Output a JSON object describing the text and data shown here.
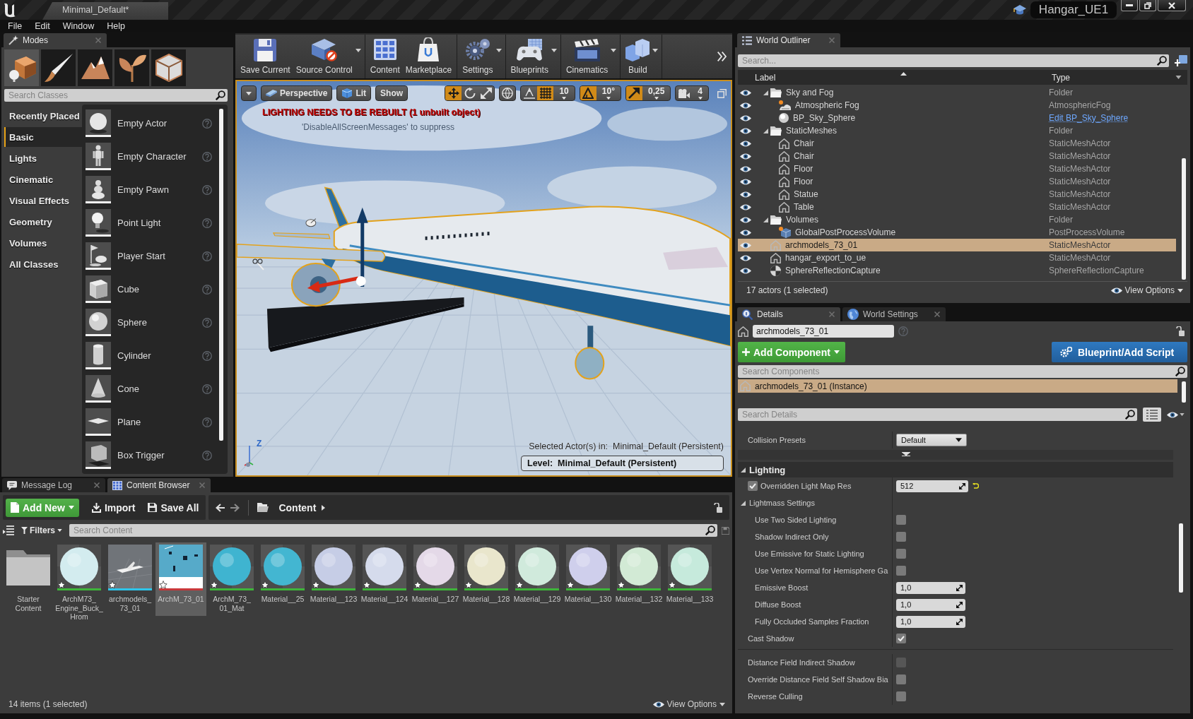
{
  "title_bar": {
    "document": "Minimal_Default*",
    "project": "Hangar_UE1"
  },
  "menu": [
    "File",
    "Edit",
    "Window",
    "Help"
  ],
  "modes": {
    "tab": "Modes",
    "mode_buttons": [
      {
        "kind": "place",
        "selected": true
      },
      {
        "kind": "paint",
        "selected": false
      },
      {
        "kind": "landscape",
        "selected": false
      },
      {
        "kind": "foliage",
        "selected": false
      },
      {
        "kind": "geometry",
        "selected": false
      }
    ],
    "search": {
      "placeholder": "Search Classes"
    },
    "categories": [
      {
        "label": "Recently Placed",
        "selected": false
      },
      {
        "label": "Basic",
        "selected": true
      },
      {
        "label": "Lights",
        "selected": false
      },
      {
        "label": "Cinematic",
        "selected": false
      },
      {
        "label": "Visual Effects",
        "selected": false
      },
      {
        "label": "Geometry",
        "selected": false
      },
      {
        "label": "Volumes",
        "selected": false
      },
      {
        "label": "All Classes",
        "selected": false
      }
    ],
    "items": [
      {
        "label": "Empty Actor",
        "kind": "ball"
      },
      {
        "label": "Empty Character",
        "kind": "figure"
      },
      {
        "label": "Empty Pawn",
        "kind": "pawn"
      },
      {
        "label": "Point Light",
        "kind": "bulb"
      },
      {
        "label": "Player Start",
        "kind": "flag"
      },
      {
        "label": "Cube",
        "kind": "cube"
      },
      {
        "label": "Sphere",
        "kind": "sphere"
      },
      {
        "label": "Cylinder",
        "kind": "cylinder"
      },
      {
        "label": "Cone",
        "kind": "cone"
      },
      {
        "label": "Plane",
        "kind": "plane"
      },
      {
        "label": "Box Trigger",
        "kind": "trigger"
      }
    ]
  },
  "toolbar": {
    "groups": [
      [
        {
          "label": "Save Current",
          "kind": "save",
          "dropdown": false
        },
        {
          "label": "Source Control",
          "kind": "source",
          "dropdown": true
        }
      ],
      [
        {
          "label": "Content",
          "kind": "content",
          "dropdown": false
        },
        {
          "label": "Marketplace",
          "kind": "market",
          "dropdown": false
        }
      ],
      [
        {
          "label": "Settings",
          "kind": "settings",
          "dropdown": true
        }
      ],
      [
        {
          "label": "Blueprints",
          "kind": "blueprints",
          "dropdown": true
        }
      ],
      [
        {
          "label": "Cinematics",
          "kind": "cinematics",
          "dropdown": true
        }
      ],
      [
        {
          "label": "Build",
          "kind": "build",
          "dropdown": true
        }
      ]
    ]
  },
  "viewport": {
    "buttons": [
      {
        "label": "Perspective",
        "kind": "perspective"
      },
      {
        "label": "Lit",
        "kind": "lit"
      },
      {
        "label": "Show",
        "kind": "plain"
      }
    ],
    "tool_groups": [
      [
        {
          "kind": "translate",
          "on": true
        },
        {
          "kind": "rotate",
          "on": false
        },
        {
          "kind": "scale",
          "on": false
        }
      ],
      [
        {
          "kind": "world",
          "on": false
        }
      ],
      [
        {
          "kind": "surface",
          "on": false
        },
        {
          "kind": "grid",
          "on": true,
          "value": "10"
        }
      ],
      [
        {
          "kind": "angle",
          "on": true,
          "value": "10°"
        }
      ],
      [
        {
          "kind": "scalesnap",
          "on": true,
          "value": "0,25"
        }
      ],
      [
        {
          "kind": "camera",
          "on": false,
          "value": "4"
        }
      ]
    ],
    "warning": "LIGHTING NEEDS TO BE REBUILT (1 unbuilt object)",
    "hint": "'DisableAllScreenMessages' to suppress",
    "axis": "Z",
    "selection": "Selected Actor(s) in:  Minimal_Default (Persistent)",
    "level": "Level:  Minimal_Default (Persistent)"
  },
  "content_browser": {
    "tabs": [
      {
        "label": "Message Log",
        "kind": "log",
        "selected": false
      },
      {
        "label": "Content Browser",
        "kind": "browser",
        "selected": true
      }
    ],
    "add_new": "Add New",
    "import": "Import",
    "save_all": "Save All",
    "path": "Content",
    "filters": "Filters",
    "search": {
      "placeholder": "Search Content"
    },
    "assets": [
      {
        "label": "Starter Content",
        "kind": "folder",
        "selected": false
      },
      {
        "label": "ArchM73_Engine_Buck_Hrom",
        "kind": "material",
        "color": "#d3ecef",
        "selected": false
      },
      {
        "label": "archmodels_73_01",
        "kind": "mesh",
        "selected": false
      },
      {
        "label": "ArchM_73_01",
        "kind": "texture",
        "selected": true
      },
      {
        "label": "ArchM_73_01_Mat",
        "kind": "material",
        "color": "#3fb4d0",
        "selected": false
      },
      {
        "label": "Material__25",
        "kind": "material",
        "color": "#43b6d1",
        "selected": false
      },
      {
        "label": "Material__123",
        "kind": "material",
        "color": "#c6cde6",
        "selected": false
      },
      {
        "label": "Material__124",
        "kind": "material",
        "color": "#d5dbec",
        "selected": false
      },
      {
        "label": "Material__127",
        "kind": "material",
        "color": "#e4d9e8",
        "selected": false
      },
      {
        "label": "Material__128",
        "kind": "material",
        "color": "#e9e6cc",
        "selected": false
      },
      {
        "label": "Material__129",
        "kind": "material",
        "color": "#d0eadc",
        "selected": false
      },
      {
        "label": "Material__130",
        "kind": "material",
        "color": "#cfcfec",
        "selected": false
      },
      {
        "label": "Material__132",
        "kind": "material",
        "color": "#d2ead5",
        "selected": false
      },
      {
        "label": "Material__133",
        "kind": "material",
        "color": "#c6eadc",
        "selected": false
      }
    ],
    "status": "14 items (1 selected)",
    "view_options": "View Options"
  },
  "outliner": {
    "tab": "World Outliner",
    "search": {
      "placeholder": "Search..."
    },
    "columns": [
      "Label",
      "Type"
    ],
    "rows": [
      {
        "label": "Sky and Fog",
        "kind": "folder",
        "type": "Folder",
        "link": false,
        "selected": false,
        "expanded": true,
        "children": [
          {
            "label": "Atmospheric Fog",
            "kind": "fog",
            "type": "AtmosphericFog",
            "link": false,
            "selected": false
          },
          {
            "label": "BP_Sky_Sphere",
            "kind": "sphere",
            "type": "Edit BP_Sky_Sphere",
            "link": true,
            "selected": false
          }
        ]
      },
      {
        "label": "StaticMeshes",
        "kind": "folder",
        "type": "Folder",
        "link": false,
        "selected": false,
        "expanded": true,
        "children": [
          {
            "label": "Chair",
            "kind": "mesh",
            "type": "StaticMeshActor",
            "link": false,
            "selected": false
          },
          {
            "label": "Chair",
            "kind": "mesh",
            "type": "StaticMeshActor",
            "link": false,
            "selected": false
          },
          {
            "label": "Floor",
            "kind": "mesh",
            "type": "StaticMeshActor",
            "link": false,
            "selected": false
          },
          {
            "label": "Floor",
            "kind": "mesh",
            "type": "StaticMeshActor",
            "link": false,
            "selected": false
          },
          {
            "label": "Statue",
            "kind": "mesh",
            "type": "StaticMeshActor",
            "link": false,
            "selected": false
          },
          {
            "label": "Table",
            "kind": "mesh",
            "type": "StaticMeshActor",
            "link": false,
            "selected": false
          }
        ]
      },
      {
        "label": "Volumes",
        "kind": "folder",
        "type": "Folder",
        "link": false,
        "selected": false,
        "expanded": true,
        "children": [
          {
            "label": "GlobalPostProcessVolume",
            "kind": "volume",
            "type": "PostProcessVolume",
            "link": false,
            "selected": false
          }
        ]
      },
      {
        "label": "archmodels_73_01",
        "kind": "mesh",
        "type": "StaticMeshActor",
        "link": false,
        "selected": true
      },
      {
        "label": "hangar_export_to_ue",
        "kind": "mesh",
        "type": "StaticMeshActor",
        "link": false,
        "selected": false
      },
      {
        "label": "SphereReflectionCapture",
        "kind": "capture",
        "type": "SphereReflectionCapture",
        "link": false,
        "selected": false
      }
    ],
    "status": "17 actors (1 selected)",
    "view_options": "View Options"
  },
  "details": {
    "tabs": [
      {
        "label": "Details",
        "kind": "details",
        "selected": true
      },
      {
        "label": "World Settings",
        "kind": "world",
        "selected": false
      }
    ],
    "actor": {
      "value": "archmodels_73_01"
    },
    "add_component": "Add Component",
    "blueprint": "Blueprint/Add Script",
    "component_search": {
      "placeholder": "Search Components"
    },
    "components": [
      {
        "label": "archmodels_73_01 (Instance)",
        "selected": true
      }
    ],
    "search": {
      "placeholder": "Search Details"
    },
    "properties": [
      {
        "kind": "dropdown",
        "label": "Collision Presets",
        "value": "Default"
      },
      {
        "kind": "advanced"
      },
      {
        "kind": "section",
        "label": "Lighting",
        "expanded": true
      },
      {
        "kind": "number",
        "label": "Overridden Light Map Res",
        "value": "512",
        "checked": true,
        "reset": true
      },
      {
        "kind": "group",
        "label": "Lightmass Settings",
        "expanded": true,
        "children": [
          {
            "kind": "checkbox",
            "label": "Use Two Sided Lighting",
            "checked": false,
            "disabled": false
          },
          {
            "kind": "checkbox",
            "label": "Shadow Indirect Only",
            "checked": false,
            "disabled": false
          },
          {
            "kind": "checkbox",
            "label": "Use Emissive for Static Lighting",
            "checked": false,
            "disabled": false
          },
          {
            "kind": "checkbox",
            "label": "Use Vertex Normal for Hemisphere Ga",
            "checked": false,
            "disabled": false
          },
          {
            "kind": "number",
            "label": "Emissive Boost",
            "value": "1,0",
            "reset": false
          },
          {
            "kind": "number",
            "label": "Diffuse Boost",
            "value": "1,0",
            "reset": false
          },
          {
            "kind": "number",
            "label": "Fully Occluded Samples Fraction",
            "value": "1,0",
            "reset": false
          }
        ]
      },
      {
        "kind": "checkbox",
        "label": "Cast Shadow",
        "checked": true,
        "disabled": false
      },
      {
        "kind": "separator"
      },
      {
        "kind": "checkbox",
        "label": "Distance Field Indirect Shadow",
        "checked": false,
        "disabled": true
      },
      {
        "kind": "checkbox",
        "label": "Override Distance Field Self Shadow Bia",
        "checked": false,
        "disabled": false
      },
      {
        "kind": "checkbox",
        "label": "Reverse Culling",
        "checked": false,
        "disabled": false
      }
    ]
  }
}
